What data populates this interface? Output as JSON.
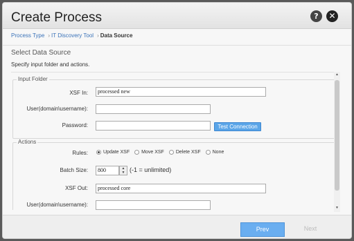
{
  "dialog": {
    "title": "Create Process",
    "help_icon": "question-mark",
    "close_icon": "close-x"
  },
  "breadcrumb": {
    "items": [
      "Process Type",
      "IT Discovery Tool",
      "Data Source"
    ],
    "separator": "›"
  },
  "section": {
    "title": "Select Data Source",
    "description": "Specify input folder and actions."
  },
  "input_folder": {
    "legend": "Input Folder",
    "xsf_in_label": "XSF In:",
    "xsf_in_value": "processed new",
    "user_label": "User(domain\\username):",
    "user_value": "",
    "password_label": "Password:",
    "password_value": "",
    "test_connection_label": "Test Connection"
  },
  "actions": {
    "legend": "Actions",
    "rules_label": "Rules:",
    "rules": [
      {
        "label": "Update XSF",
        "selected": true
      },
      {
        "label": "Move XSF",
        "selected": false
      },
      {
        "label": "Delete XSF",
        "selected": false
      },
      {
        "label": "None",
        "selected": false
      }
    ],
    "batch_size_label": "Batch Size:",
    "batch_size_value": "800",
    "batch_size_hint": "(-1 = unlimited)",
    "xsf_out_label": "XSF Out:",
    "xsf_out_value": "processed core",
    "user_label": "User(domain\\username):",
    "user_value": ""
  },
  "footer": {
    "prev_label": "Prev",
    "next_label": "Next"
  },
  "colors": {
    "accent": "#6aaef0",
    "test_button": "#5aa5e8",
    "link": "#3b73b9"
  }
}
